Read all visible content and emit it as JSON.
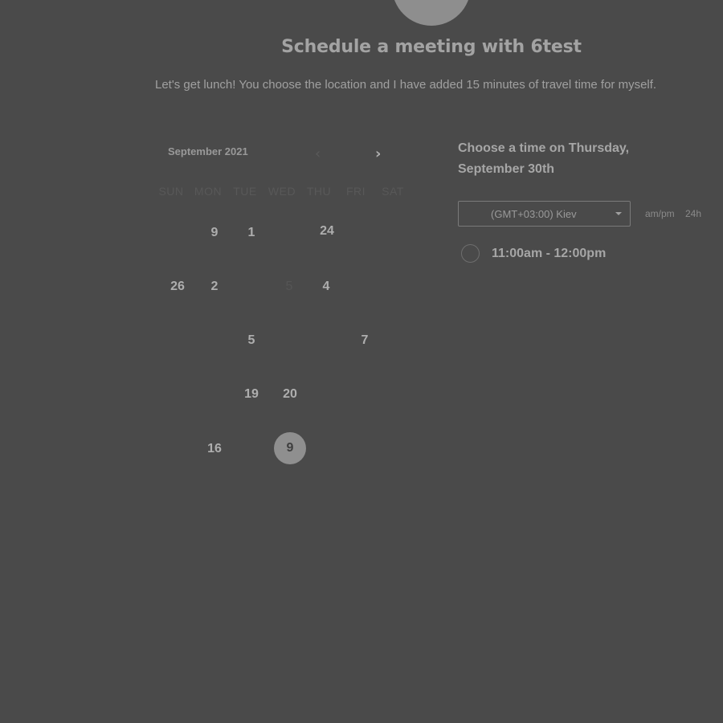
{
  "header": {
    "title": "Schedule a meeting with 6test",
    "description": "Let's get lunch! You choose the location and I have added 15 minutes of travel time for myself."
  },
  "calendar": {
    "month_label": "September 2021",
    "prev_icon": "chevron-left-icon",
    "next_icon": "chevron-right-icon",
    "weekdays": [
      "SUN",
      "MON",
      "TUE",
      "WED",
      "THU",
      "FRI",
      "SAT"
    ],
    "weeks": [
      [
        {
          "label": "",
          "available": false
        },
        {
          "label": "9",
          "available": true
        },
        {
          "label": "1",
          "available": true
        },
        {
          "label": "",
          "available": false
        },
        {
          "label": "24",
          "available": true
        },
        {
          "label": "",
          "available": false
        },
        {
          "label": "",
          "available": false
        }
      ],
      [
        {
          "label": "26",
          "available": true
        },
        {
          "label": "2",
          "available": true
        },
        {
          "label": "",
          "available": false
        },
        {
          "label": "5",
          "available": false
        },
        {
          "label": "4",
          "available": true
        },
        {
          "label": "",
          "available": false
        },
        {
          "label": "",
          "available": false
        }
      ],
      [
        {
          "label": "",
          "available": false
        },
        {
          "label": "",
          "available": false
        },
        {
          "label": "5",
          "available": true
        },
        {
          "label": "",
          "available": false
        },
        {
          "label": "",
          "available": false
        },
        {
          "label": "7",
          "available": true
        },
        {
          "label": "",
          "available": false
        }
      ],
      [
        {
          "label": "",
          "available": false
        },
        {
          "label": "",
          "available": false
        },
        {
          "label": "19",
          "available": true
        },
        {
          "label": "20",
          "available": true
        },
        {
          "label": "",
          "available": false
        },
        {
          "label": "",
          "available": false
        },
        {
          "label": "",
          "available": false
        }
      ],
      [
        {
          "label": "",
          "available": false
        },
        {
          "label": "16",
          "available": true
        },
        {
          "label": "",
          "available": false
        },
        {
          "label": "9",
          "available": true,
          "selected": true
        },
        {
          "label": "",
          "available": false
        },
        {
          "label": "",
          "available": false
        },
        {
          "label": "",
          "available": false
        }
      ]
    ]
  },
  "times": {
    "heading": "Choose a time on Thursday, September 30th",
    "timezone": "(GMT+03:00) Kiev",
    "format_ampm": "am/pm",
    "format_24h": "24h",
    "slots": [
      "11:00am - 12:00pm"
    ]
  }
}
